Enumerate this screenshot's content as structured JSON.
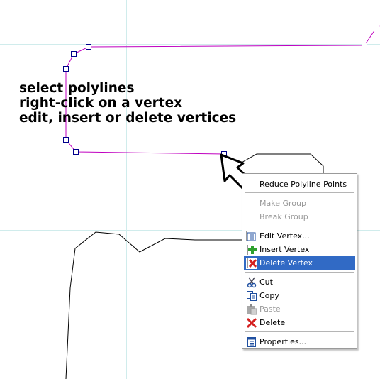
{
  "instructions": {
    "line1": "select polylines",
    "line2": "right-click on a vertex",
    "line3": "edit, insert or delete vertices"
  },
  "colors": {
    "polyline_selected": "#c000c0",
    "vertex_handle": "#00008b",
    "grid": "#d0ecec",
    "menu_highlight": "#316ac5"
  },
  "context_menu": {
    "reduce_points": "Reduce Polyline Points",
    "make_group": "Make Group",
    "break_group": "Break Group",
    "edit_vertex": "Edit Vertex...",
    "insert_vertex": "Insert Vertex",
    "delete_vertex": "Delete Vertex",
    "cut": "Cut",
    "copy": "Copy",
    "paste": "Paste",
    "delete": "Delete",
    "properties": "Properties..."
  },
  "menu_icons": {
    "edit_vertex": "edit-vertex-icon",
    "insert_vertex": "insert-vertex-icon",
    "delete_vertex": "delete-vertex-icon",
    "cut": "scissors-icon",
    "copy": "copy-icon",
    "paste": "paste-icon",
    "delete": "red-x-icon",
    "properties": "properties-icon"
  }
}
